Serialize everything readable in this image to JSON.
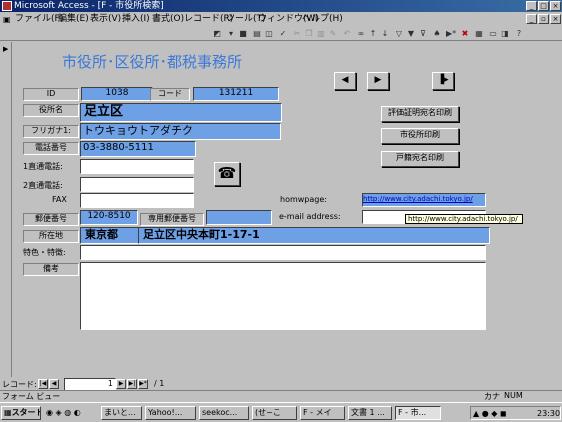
{
  "window": {
    "title": "Microsoft Access - [F - 市役所検索]"
  },
  "menu": [
    "ファイル(F)",
    "編集(E)",
    "表示(V)",
    "挿入(I)",
    "書式(O)",
    "レコード(R)",
    "ツール(T)",
    "ウィンドウ(W)",
    "ヘルプ(H)"
  ],
  "form": {
    "heading": "市役所･区役所･都税事務所",
    "labels": {
      "id": "ID",
      "code": "コード",
      "name": "役所名",
      "furigana": "フリガナ1:",
      "phone": "電話番号",
      "direct1": "1直通電話:",
      "direct2": "2直通電話:",
      "fax": "FAX",
      "postal": "郵便番号",
      "dedicated_postal": "専用郵便番号",
      "address": "所在地",
      "notes_special": "特色・特徴:",
      "remarks": "備考",
      "homepage": "homwpage:",
      "email": "e-mail address:"
    },
    "values": {
      "id": "1038",
      "code": "131211",
      "name": "足立区",
      "furigana": "トウキョウトアダチク",
      "phone": "03-3880-5111",
      "postal": "120-8510",
      "pref": "東京都",
      "address": "足立区中央本町1-17-1",
      "homepage": "http://www.city.adachi.tokyo.jp/",
      "tooltip": "http://www.city.adachi.tokyo.jp/"
    },
    "buttons": {
      "eval_print": "評価証明宛名印刷",
      "office_print": "市役所印刷",
      "family_print": "戸籍宛名印刷"
    }
  },
  "recnav": {
    "label": "レコード:",
    "current": "1",
    "of": "/ 1"
  },
  "status": {
    "left": "フォーム ビュー",
    "kana": "カナ",
    "num": "NUM"
  },
  "taskbar": {
    "start": "スタート",
    "tasks": [
      "まいと...",
      "Yahoo!...",
      "seekoc...",
      "(せ~こ",
      "F - メイ",
      "文書 1 ...",
      "F - 市..."
    ],
    "clock": "23:30"
  }
}
